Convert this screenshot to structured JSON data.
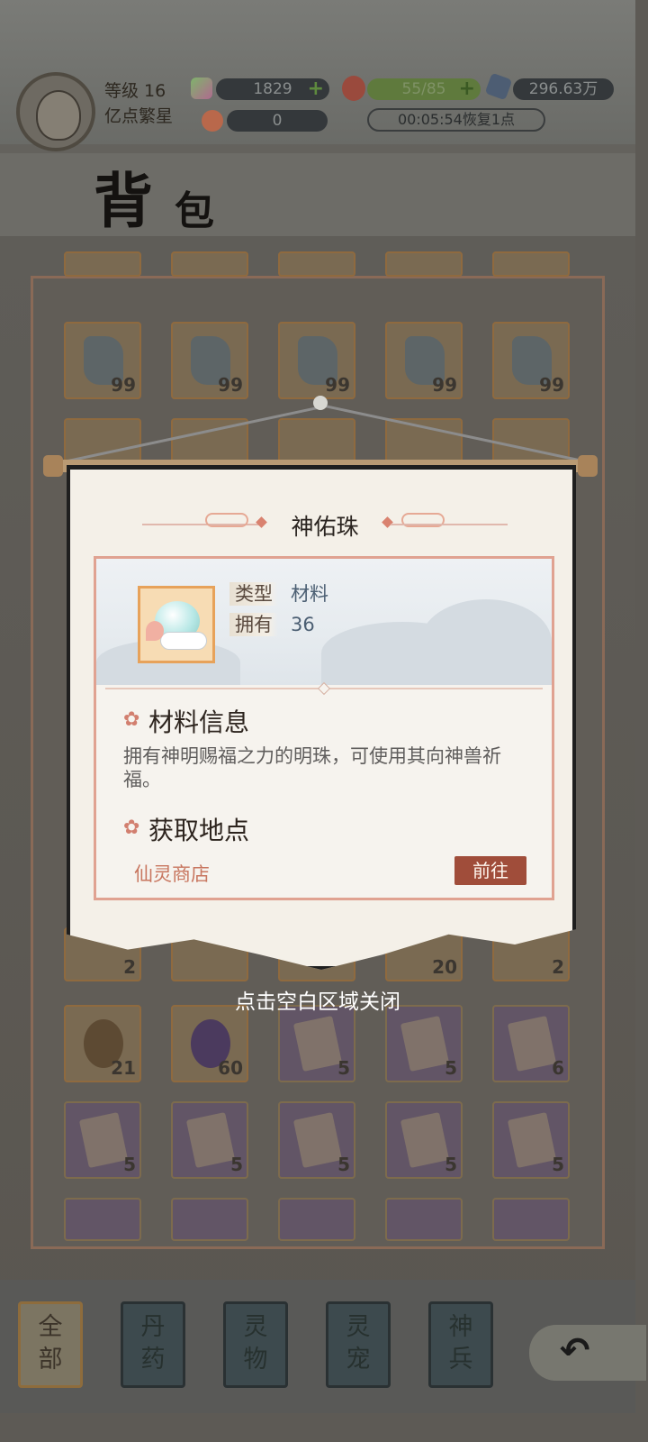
{
  "header": {
    "level": "等级 16",
    "nickname": "亿点繁星",
    "currency1": "1829",
    "currency2": "0",
    "stamina": "55/85",
    "gems": "296.63万",
    "recover_timer": "00:05:54恢复1点"
  },
  "page": {
    "title_char1": "背",
    "title_char2": "包"
  },
  "inventory_counts": {
    "row1": [
      "99",
      "99",
      "99",
      "99",
      "99"
    ],
    "row_partial_low": [
      "2",
      "",
      "",
      "20",
      "2"
    ],
    "row2": [
      "21",
      "60",
      "5",
      "5",
      "6"
    ],
    "row3": [
      "5",
      "5",
      "5",
      "5",
      "5"
    ]
  },
  "popup": {
    "item_name": "神佑珠",
    "type_label": "类型",
    "type_value": "材料",
    "own_label": "拥有",
    "own_value": "36",
    "info_title": "材料信息",
    "description": "拥有神明赐福之力的明珠，可使用其向神兽祈福。",
    "source_title": "获取地点",
    "source_name": "仙灵商店",
    "goto_label": "前往"
  },
  "close_hint": "点击空白区域关闭",
  "tabs": [
    {
      "label": "全部",
      "active": true
    },
    {
      "label": "丹药",
      "active": false
    },
    {
      "label": "灵物",
      "active": false
    },
    {
      "label": "灵宠",
      "active": false
    },
    {
      "label": "神兵",
      "active": false
    }
  ],
  "icons": {
    "back": "back-arrow-icon",
    "flower": "flower-icon",
    "plus": "plus-icon"
  },
  "colors": {
    "accent": "#a04d3a",
    "source_text": "#c8765f",
    "card_border": "#e0a291"
  }
}
